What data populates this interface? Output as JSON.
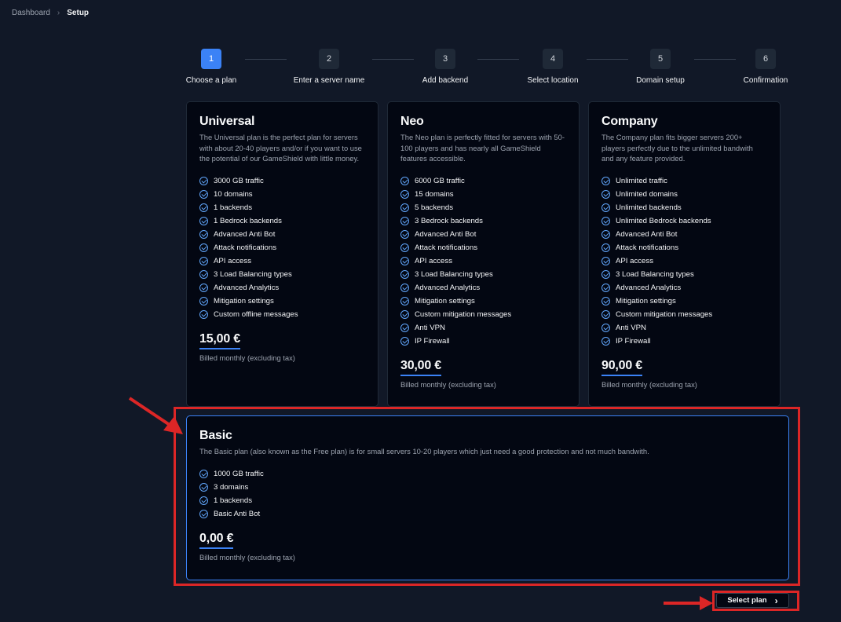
{
  "breadcrumb": {
    "items": [
      "Dashboard",
      "Setup"
    ]
  },
  "stepper": {
    "steps": [
      {
        "number": "1",
        "label": "Choose a plan"
      },
      {
        "number": "2",
        "label": "Enter a server name"
      },
      {
        "number": "3",
        "label": "Add backend"
      },
      {
        "number": "4",
        "label": "Select location"
      },
      {
        "number": "5",
        "label": "Domain setup"
      },
      {
        "number": "6",
        "label": "Confirmation"
      }
    ],
    "active_step": 1
  },
  "plans": [
    {
      "name": "Universal",
      "description": "The Universal plan is the perfect plan for servers with about 20-40 players and/or if you want to use the potential of our GameShield with little money.",
      "features": [
        "3000 GB traffic",
        "10 domains",
        "1 backends",
        "1 Bedrock backends",
        "Advanced Anti Bot",
        "Attack notifications",
        "API access",
        "3 Load Balancing types",
        "Advanced Analytics",
        "Mitigation settings",
        "Custom offline messages"
      ],
      "price": "15,00 €",
      "billing": "Billed monthly (excluding tax)"
    },
    {
      "name": "Neo",
      "description": "The Neo plan is perfectly fitted for servers with 50-100 players and has nearly all GameShield features accessible.",
      "features": [
        "6000 GB traffic",
        "15 domains",
        "5 backends",
        "3 Bedrock backends",
        "Advanced Anti Bot",
        "Attack notifications",
        "API access",
        "3 Load Balancing types",
        "Advanced Analytics",
        "Mitigation settings",
        "Custom mitigation messages",
        "Anti VPN",
        "IP Firewall"
      ],
      "price": "30,00 €",
      "billing": "Billed monthly (excluding tax)"
    },
    {
      "name": "Company",
      "description": "The Company plan fits bigger servers 200+ players perfectly due to the unlimited bandwith and any feature provided.",
      "features": [
        "Unlimited traffic",
        "Unlimited domains",
        "Unlimited backends",
        "Unlimited Bedrock backends",
        "Advanced Anti Bot",
        "Attack notifications",
        "API access",
        "3 Load Balancing types",
        "Advanced Analytics",
        "Mitigation settings",
        "Custom mitigation messages",
        "Anti VPN",
        "IP Firewall"
      ],
      "price": "90,00 €",
      "billing": "Billed monthly (excluding tax)"
    },
    {
      "name": "Basic",
      "description": "The Basic plan (also known as the Free plan) is for small servers 10-20 players which just need a good protection and not much bandwith.",
      "features": [
        "1000 GB traffic",
        "3 domains",
        "1 backends",
        "Basic Anti Bot"
      ],
      "price": "0,00 €",
      "billing": "Billed monthly (excluding tax)",
      "selected": true
    }
  ],
  "actions": {
    "select_plan_label": "Select plan",
    "select_plan_icon": "chevron-right-icon"
  },
  "colors": {
    "background": "#111827",
    "card": "#030712",
    "accent": "#3b82f6",
    "annotation_red": "#dc2626"
  }
}
